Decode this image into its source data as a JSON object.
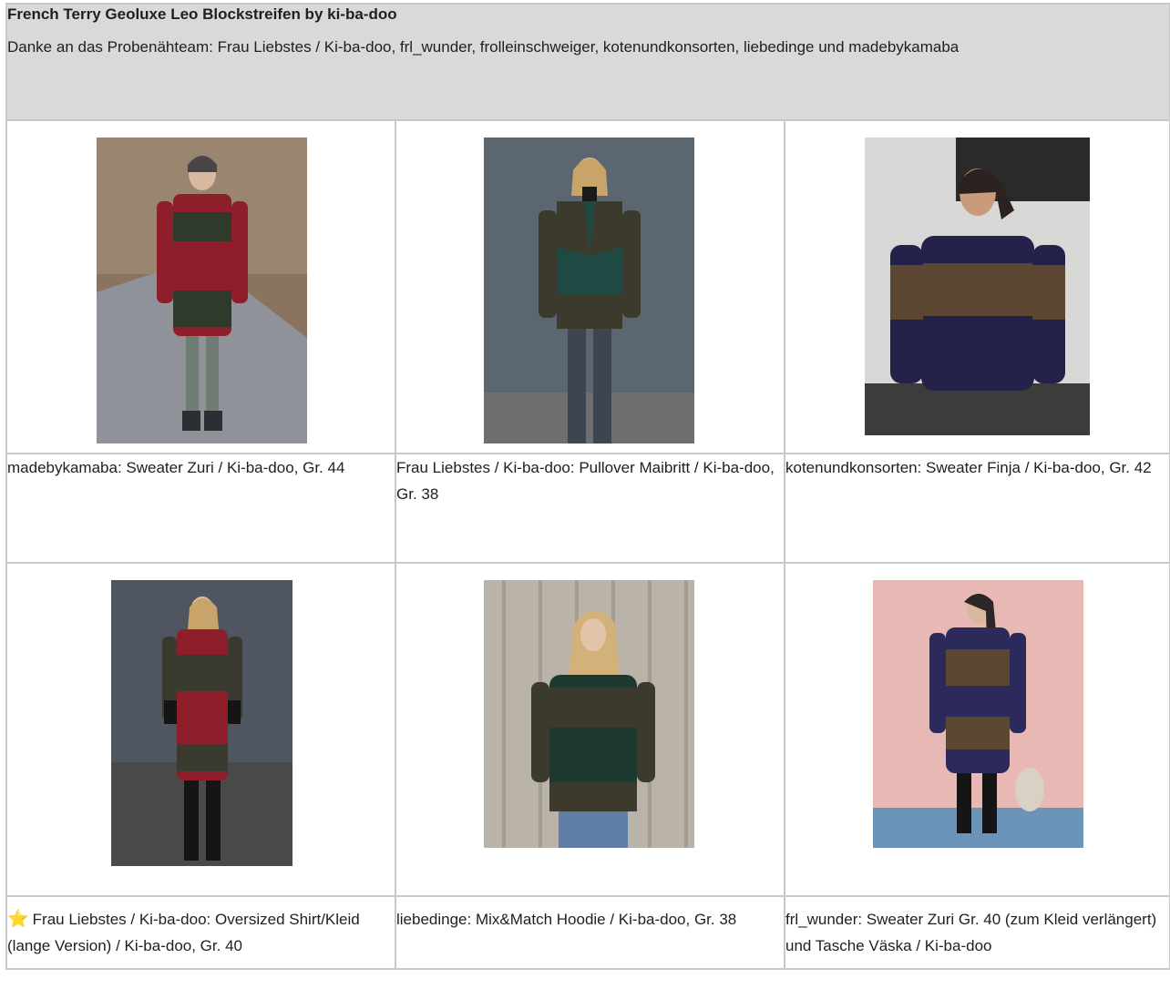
{
  "header": {
    "title": "French Terry Geoluxe Leo Blockstreifen by ki-ba-doo",
    "subtitle": "Danke an das Probenähteam: Frau Liebstes / Ki-ba-doo, frl_wunder, frolleinschweiger, kotenundkonsorten, liebedinge und madebykamaba"
  },
  "cells": [
    {
      "caption": "madebykamaba: Sweater Zuri / Ki-ba-doo, Gr. 44",
      "photo_alt": "Frau in rotem Sweaterkleid mit Leopardenmuster im Park"
    },
    {
      "caption": "Frau Liebstes / Ki-ba-doo: Pullover Maibritt / Ki-ba-doo, Gr. 38",
      "photo_alt": "Frau in grünem Pullover mit Leopardenmuster vor grauer Wand"
    },
    {
      "caption": "kotenundkonsorten: Sweater Finja / Ki-ba-doo, Gr. 42",
      "photo_alt": "Frau in dunkelblauem Sweater mit Leopardenstreifen"
    },
    {
      "caption": "Frau Liebstes / Ki-ba-doo: Oversized Shirt/Kleid (lange Version) / Ki-ba-doo, Gr. 40",
      "photo_alt": "Frau in rotem Oversized Kleid mit Leopardenmuster",
      "star": "⭐"
    },
    {
      "caption": "liebedinge: Mix&Match Hoodie / Ki-ba-doo, Gr. 38",
      "photo_alt": "Frau in grünem Hoodie mit Leopardenmuster vor Holzwand"
    },
    {
      "caption": "frl_wunder: Sweater Zuri Gr. 40 (zum Kleid verlängert) und Tasche Väska / Ki-ba-doo",
      "photo_alt": "Frau in dunkelblauem Sweaterkleid vor rosa Wand"
    }
  ],
  "colors": {
    "header_bg": "#d9d9d9",
    "border": "#c9c9c9",
    "text": "#1f1f1f"
  }
}
